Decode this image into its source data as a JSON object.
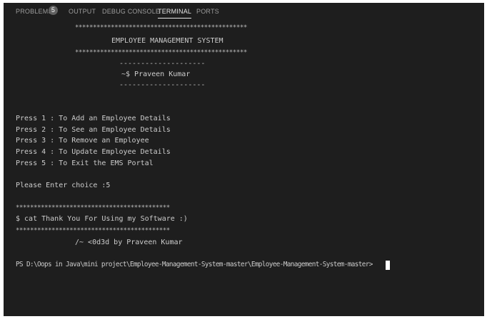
{
  "panel_tabs": {
    "problems": "PROBLEMS",
    "problems_count": "5",
    "output": "OUTPUT",
    "debug_console": "DEBUG CONSOLE",
    "terminal": "TERMINAL",
    "ports": "PORTS",
    "active_tab": "TERMINAL"
  },
  "terminal": {
    "banner_stars": "************************************************",
    "title": "EMPLOYEE MANAGEMENT SYSTEM",
    "dash_line": "--------------------",
    "author_line": "~$ Praveen Kumar",
    "menu": [
      "Press 1 : To Add an Employee Details",
      "Press 2 : To See an Employee Details",
      "Press 3 : To Remove an Employee",
      "Press 4 : To Update Employee Details",
      "Press 5 : To Exit the EMS Portal"
    ],
    "prompt_choice": "Please Enter choice :5",
    "exit_stars": "*******************************************",
    "thank_you": "$ cat Thank You For Using my Software :)",
    "credit": "/~ <0d3d by Praveen Kumar",
    "shell_prompt": "PS D:\\Oops in Java\\mini project\\Employee-Management-System-master\\Employee-Management-System-master>"
  }
}
